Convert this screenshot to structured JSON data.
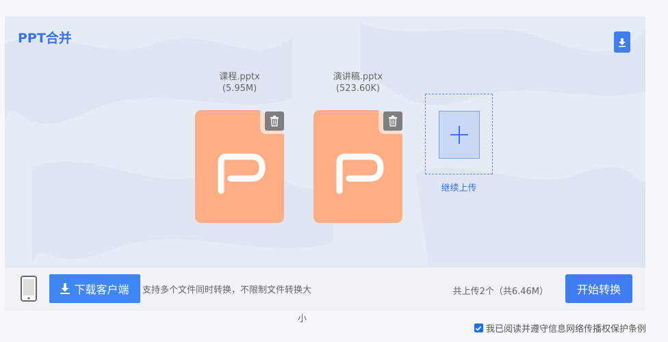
{
  "title": "PPT合并",
  "files": [
    {
      "name": "课程.pptx",
      "size": "(5.95M)"
    },
    {
      "name": "演讲稿.pptx",
      "size": "(523.60K)"
    }
  ],
  "add_more_label": "继续上传",
  "bottom_bar": {
    "client_button_label": "下载客户端",
    "support_text_line1": "支持多个文件同时转换，不限制文件转换大",
    "support_text_line2": "小",
    "total_text": "共上传2个（共6.46M）",
    "start_button_label": "开始转换"
  },
  "agreement": {
    "checked": true,
    "label": "我已阅读并遵守信息网络传播权保护条例"
  },
  "colors": {
    "accent": "#3f7df0",
    "ppt_orange": "#fdae84",
    "panel_bg": "#e6ecf5"
  },
  "icons": [
    "download-icon",
    "trash-icon",
    "plus-icon",
    "phone-icon",
    "ppt-file-icon",
    "checkbox-icon"
  ]
}
